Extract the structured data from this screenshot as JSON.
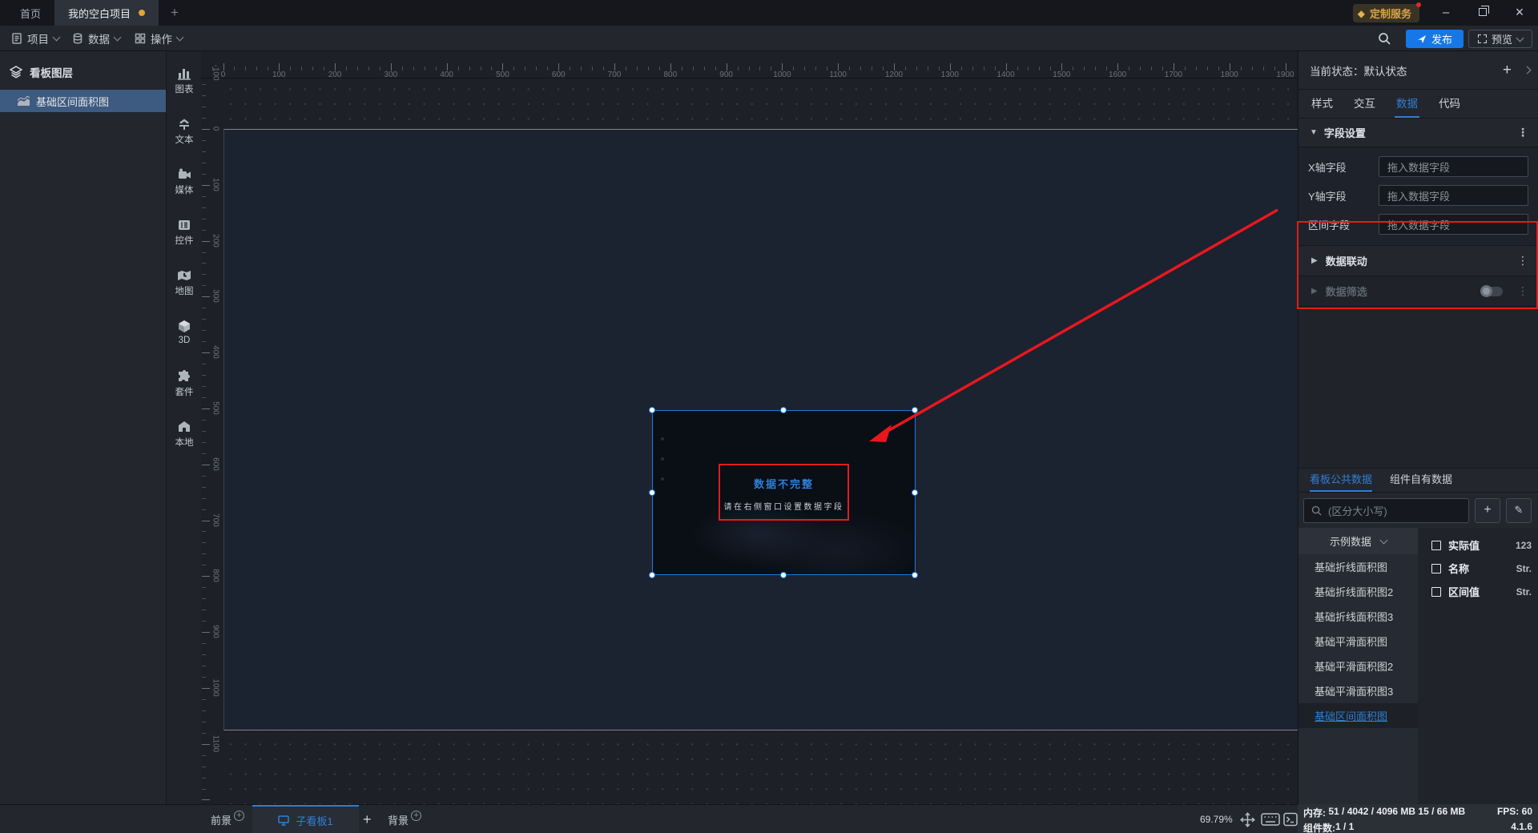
{
  "titlebar": {
    "home_tab": "首页",
    "project_tab": "我的空白项目",
    "new_tab": "+",
    "vip_button": "定制服务",
    "minimize": "–",
    "close": "×"
  },
  "menubar": {
    "items": [
      {
        "label": "项目"
      },
      {
        "label": "数据"
      },
      {
        "label": "操作"
      }
    ],
    "publish_label": "发布",
    "preview_label": "预览"
  },
  "layers_panel": {
    "title": "看板图层",
    "layers": [
      {
        "label": "基础区间面积图",
        "selected": true
      }
    ]
  },
  "toolbox": {
    "items": [
      "图表",
      "文本",
      "媒体",
      "控件",
      "地图",
      "3D",
      "套件",
      "本地"
    ]
  },
  "canvas": {
    "h_ruler_labels": [
      0,
      100,
      200,
      300,
      400,
      500,
      600,
      700,
      800,
      900,
      1000,
      1100,
      1200,
      1300,
      1400,
      1500,
      1600,
      1700,
      1800,
      1900
    ],
    "v_ruler_labels": [
      -100,
      0,
      100,
      200,
      300,
      400,
      500,
      600,
      700,
      800,
      900,
      1000,
      1100
    ],
    "component": {
      "error_title": "数据不完整",
      "error_hint": "请在右侧窗口设置数据字段"
    }
  },
  "inspector": {
    "state_label": "当前状态：",
    "state_value": "默认状态",
    "tabs": [
      "样式",
      "交互",
      "数据",
      "代码"
    ],
    "active_tab": "数据",
    "field_section_title": "字段设置",
    "fields": [
      {
        "label": "X轴字段",
        "placeholder": "拖入数据字段"
      },
      {
        "label": "Y轴字段",
        "placeholder": "拖入数据字段"
      },
      {
        "label": "区间字段",
        "placeholder": "拖入数据字段"
      }
    ],
    "data_link_title": "数据联动",
    "data_filter_title": "数据筛选",
    "accent_color": "#2f7fd6",
    "annotation_color": "#e11d1d"
  },
  "data_panel": {
    "tabs": [
      "看板公共数据",
      "组件自有数据"
    ],
    "active_tab": "看板公共数据",
    "search_placeholder": "(区分大小写)",
    "add_button": "+",
    "edit_icon": "✎",
    "dataset_selector": "示例数据",
    "datasets": [
      {
        "label": "基础折线面积图",
        "selected": false
      },
      {
        "label": "基础折线面积图2",
        "selected": false
      },
      {
        "label": "基础折线面积图3",
        "selected": false
      },
      {
        "label": "基础平滑面积图",
        "selected": false
      },
      {
        "label": "基础平滑面积图2",
        "selected": false
      },
      {
        "label": "基础平滑面积图3",
        "selected": false
      },
      {
        "label": "基础区间面积图",
        "selected": true
      }
    ],
    "fields": [
      {
        "name": "实际值",
        "type": "123"
      },
      {
        "name": "名称",
        "type": "Str."
      },
      {
        "name": "区间值",
        "type": "Str."
      }
    ]
  },
  "bottombar": {
    "foreground_label": "前景",
    "board_tab_label": "子看板1",
    "add_board": "+",
    "background_label": "背景",
    "zoom_level": "69.79%"
  },
  "statusbar": {
    "memory_label": "内存:",
    "memory_value": "51 / 4042 / 4096 MB  15 / 66 MB",
    "fps_label": "FPS:",
    "fps_value": "60",
    "component_count_label": "组件数:",
    "component_count_value": "1 / 1",
    "version": "4.1.6"
  }
}
